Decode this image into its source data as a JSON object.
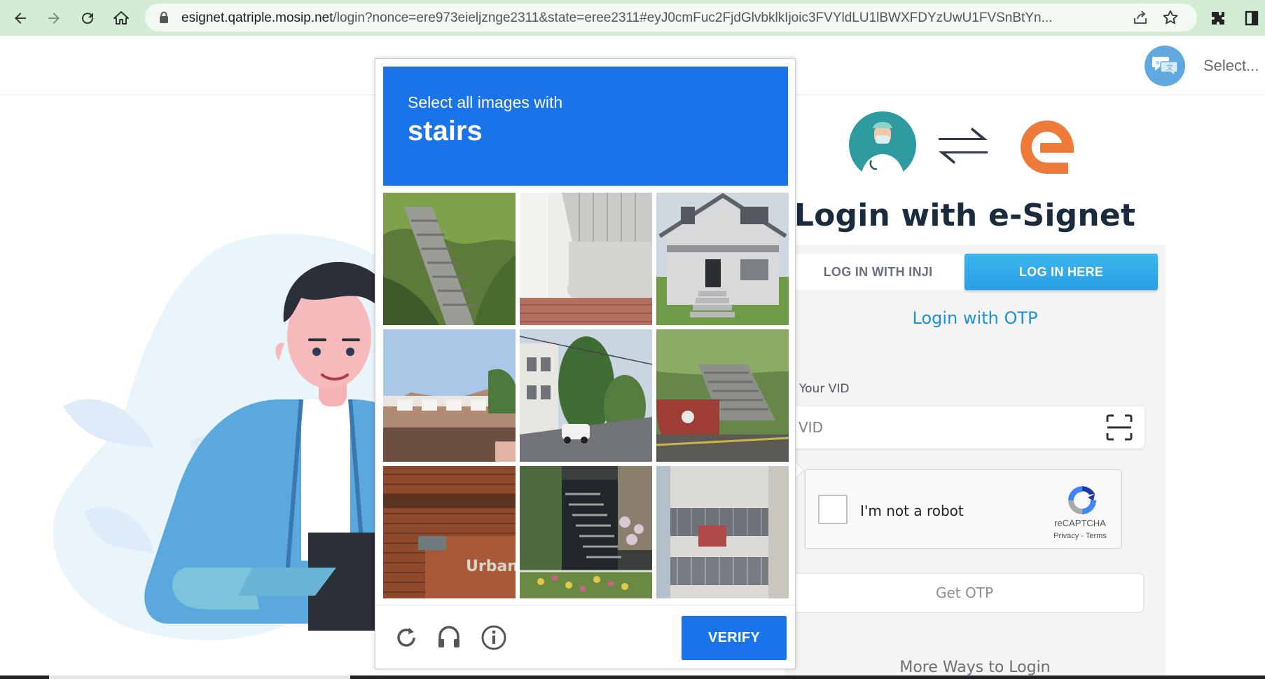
{
  "browser": {
    "url_host": "esignet.qatriple.mosip.net",
    "url_path": "/login?nonce=ere973eieljznge2311&state=eree2311#eyJ0cmFuc2FjdGlvbklkIjoic3FVYldLU1lBWXFDYzUwU1FVSnBtYn..."
  },
  "header": {
    "language_select": "Select..."
  },
  "login": {
    "title": "Login with e-Signet",
    "tab_inji": "LOG IN WITH INJI",
    "tab_here": "LOG IN HERE",
    "otp_title": "Login with OTP",
    "vid_label": "Enter Your VID",
    "vid_placeholder": "VID",
    "get_otp": "Get OTP",
    "more_ways": "More Ways to Login"
  },
  "recaptcha": {
    "label": "I'm not a robot",
    "brand": "reCAPTCHA",
    "privacy": "Privacy",
    "separator": " - ",
    "terms": "Terms"
  },
  "challenge": {
    "prompt": "Select all images with",
    "keyword": "stairs",
    "verify": "VERIFY",
    "tile_overlay_text": "Urban",
    "accent": "#1a73e8",
    "tiles": [
      "stone-steps-on-hillside",
      "white-building-corner",
      "house-porch-with-steps",
      "townhouse-row",
      "street-with-tree-and-car",
      "grass-hill-with-stairs",
      "brick-building-urban-sign",
      "outdoor-staircase-with-plants",
      "apartment-balconies"
    ],
    "footer_icons": [
      "reload-icon",
      "audio-challenge-icon",
      "info-icon"
    ]
  },
  "colors": {
    "chrome_bg": "#d3ecd4",
    "primary_blue": "#1f8fd6",
    "title_text": "#1b2a3d"
  }
}
